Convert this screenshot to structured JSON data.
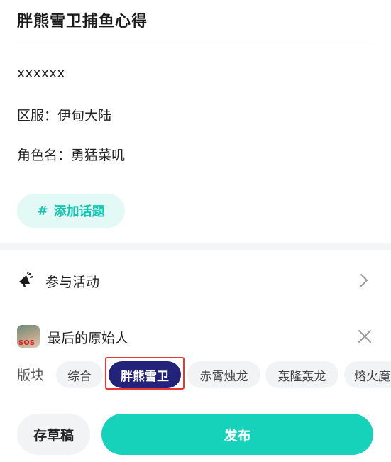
{
  "post": {
    "title": "胖熊雪卫捕鱼心得",
    "body_lines": [
      "xxxxxx",
      "区服：伊甸大陆",
      "角色名：勇猛菜叽"
    ],
    "add_topic_label": "添加话题",
    "topic_symbol": "#"
  },
  "activity": {
    "label": "参与活动",
    "icon": "megaphone-icon"
  },
  "game": {
    "name": "最后的原始人",
    "icon_badge": "SOS"
  },
  "board": {
    "label": "版块",
    "chips": [
      "综合",
      "胖熊雪卫",
      "赤霄烛龙",
      "轰隆轰龙",
      "熔火魔"
    ],
    "selected": "胖熊雪卫"
  },
  "footer": {
    "draft_label": "存草稿",
    "publish_label": "发布"
  },
  "colors": {
    "accent": "#16d2bb",
    "topic_bg": "#e3f9f6",
    "selected_chip": "#23237a",
    "highlight_frame": "#e53935"
  }
}
